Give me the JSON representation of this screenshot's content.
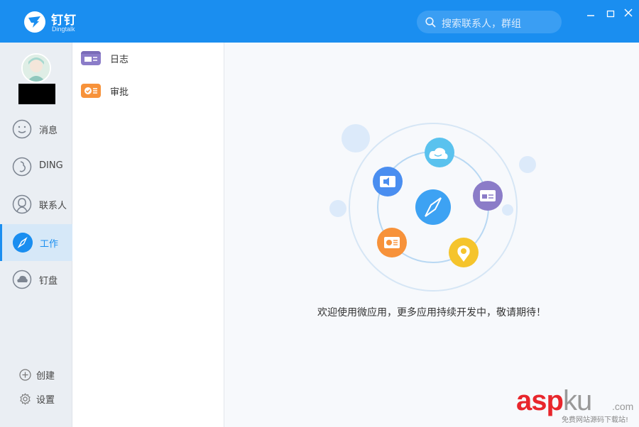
{
  "app": {
    "name": "钉钉",
    "subtitle": "Dingtalk"
  },
  "search": {
    "placeholder": "搜索联系人，群组"
  },
  "nav": {
    "items": [
      {
        "label": "消息",
        "icon": "smiley-icon"
      },
      {
        "label": "DING",
        "icon": "ding-icon"
      },
      {
        "label": "联系人",
        "icon": "contact-icon"
      },
      {
        "label": "工作",
        "icon": "compass-icon",
        "active": true
      },
      {
        "label": "钉盘",
        "icon": "cloud-drive-icon"
      }
    ],
    "create_label": "创建",
    "settings_label": "设置"
  },
  "apps": [
    {
      "label": "日志",
      "icon": "log-icon",
      "color": "#8b7cc8"
    },
    {
      "label": "审批",
      "icon": "approval-icon",
      "color": "#f7923a"
    }
  ],
  "main": {
    "welcome": "欢迎使用微应用，更多应用持续开发中，敬请期待！"
  },
  "watermark": {
    "brand_a": "asp",
    "brand_b": "ku",
    "suffix": ".com",
    "slogan": "免费网站源码下载站!"
  },
  "colors": {
    "accent": "#1a8ef0",
    "titlebar": "#1a8ef0"
  }
}
